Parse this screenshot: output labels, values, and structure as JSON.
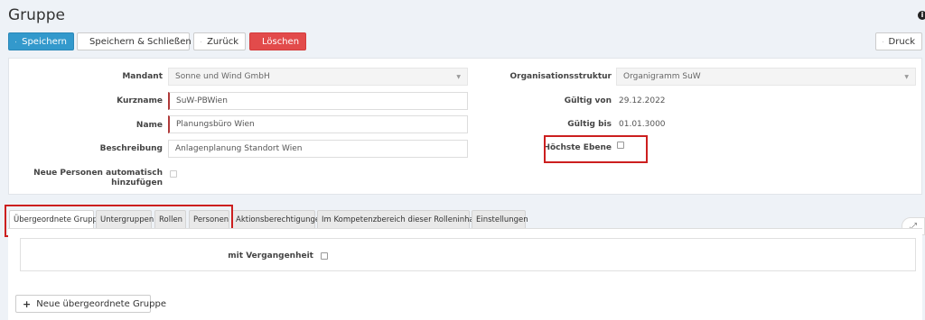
{
  "page": {
    "title": "Gruppe"
  },
  "toolbar": {
    "save": "Speichern",
    "save_close": "Speichern & Schließen",
    "back": "Zurück",
    "delete": "Löschen",
    "print": "Druck"
  },
  "form": {
    "mandant": {
      "label": "Mandant",
      "value": "Sonne und Wind GmbH"
    },
    "kurzname": {
      "label": "Kurzname",
      "value": "SuW-PBWien"
    },
    "name": {
      "label": "Name",
      "value": "Planungsbüro Wien"
    },
    "beschreibung": {
      "label": "Beschreibung",
      "value": "Anlagenplanung Standort Wien"
    },
    "neue_personen": {
      "label_line1": "Neue Personen automatisch",
      "label_line2": "hinzufügen",
      "checked": false
    },
    "organisationsstruktur": {
      "label": "Organisationsstruktur",
      "value": "Organigramm SuW"
    },
    "gueltig_von": {
      "label": "Gültig von",
      "value": "29.12.2022"
    },
    "gueltig_bis": {
      "label": "Gültig bis",
      "value": "01.01.3000"
    },
    "hoechste_ebene": {
      "label": "Höchste Ebene",
      "checked": false
    }
  },
  "tabs": [
    {
      "label": "Übergeordnete Gruppe",
      "active": true
    },
    {
      "label": "Untergruppen",
      "active": false
    },
    {
      "label": "Rollen",
      "active": false
    },
    {
      "label": "Personen",
      "active": false
    },
    {
      "label": "Aktionsberechtigungen",
      "active": false
    },
    {
      "label": "Im Kompetenzbereich dieser Rolleninhaber",
      "active": false
    },
    {
      "label": "Einstellungen",
      "active": false
    }
  ],
  "tab_content": {
    "mit_vergangenheit": {
      "label": "mit Vergangenheit",
      "checked": false
    },
    "add_button": "Neue übergeordnete Gruppe"
  },
  "colors": {
    "primary": "#3399cc",
    "danger": "#e24b4b",
    "highlight": "#cc1f1f",
    "required": "#b03a3a"
  }
}
